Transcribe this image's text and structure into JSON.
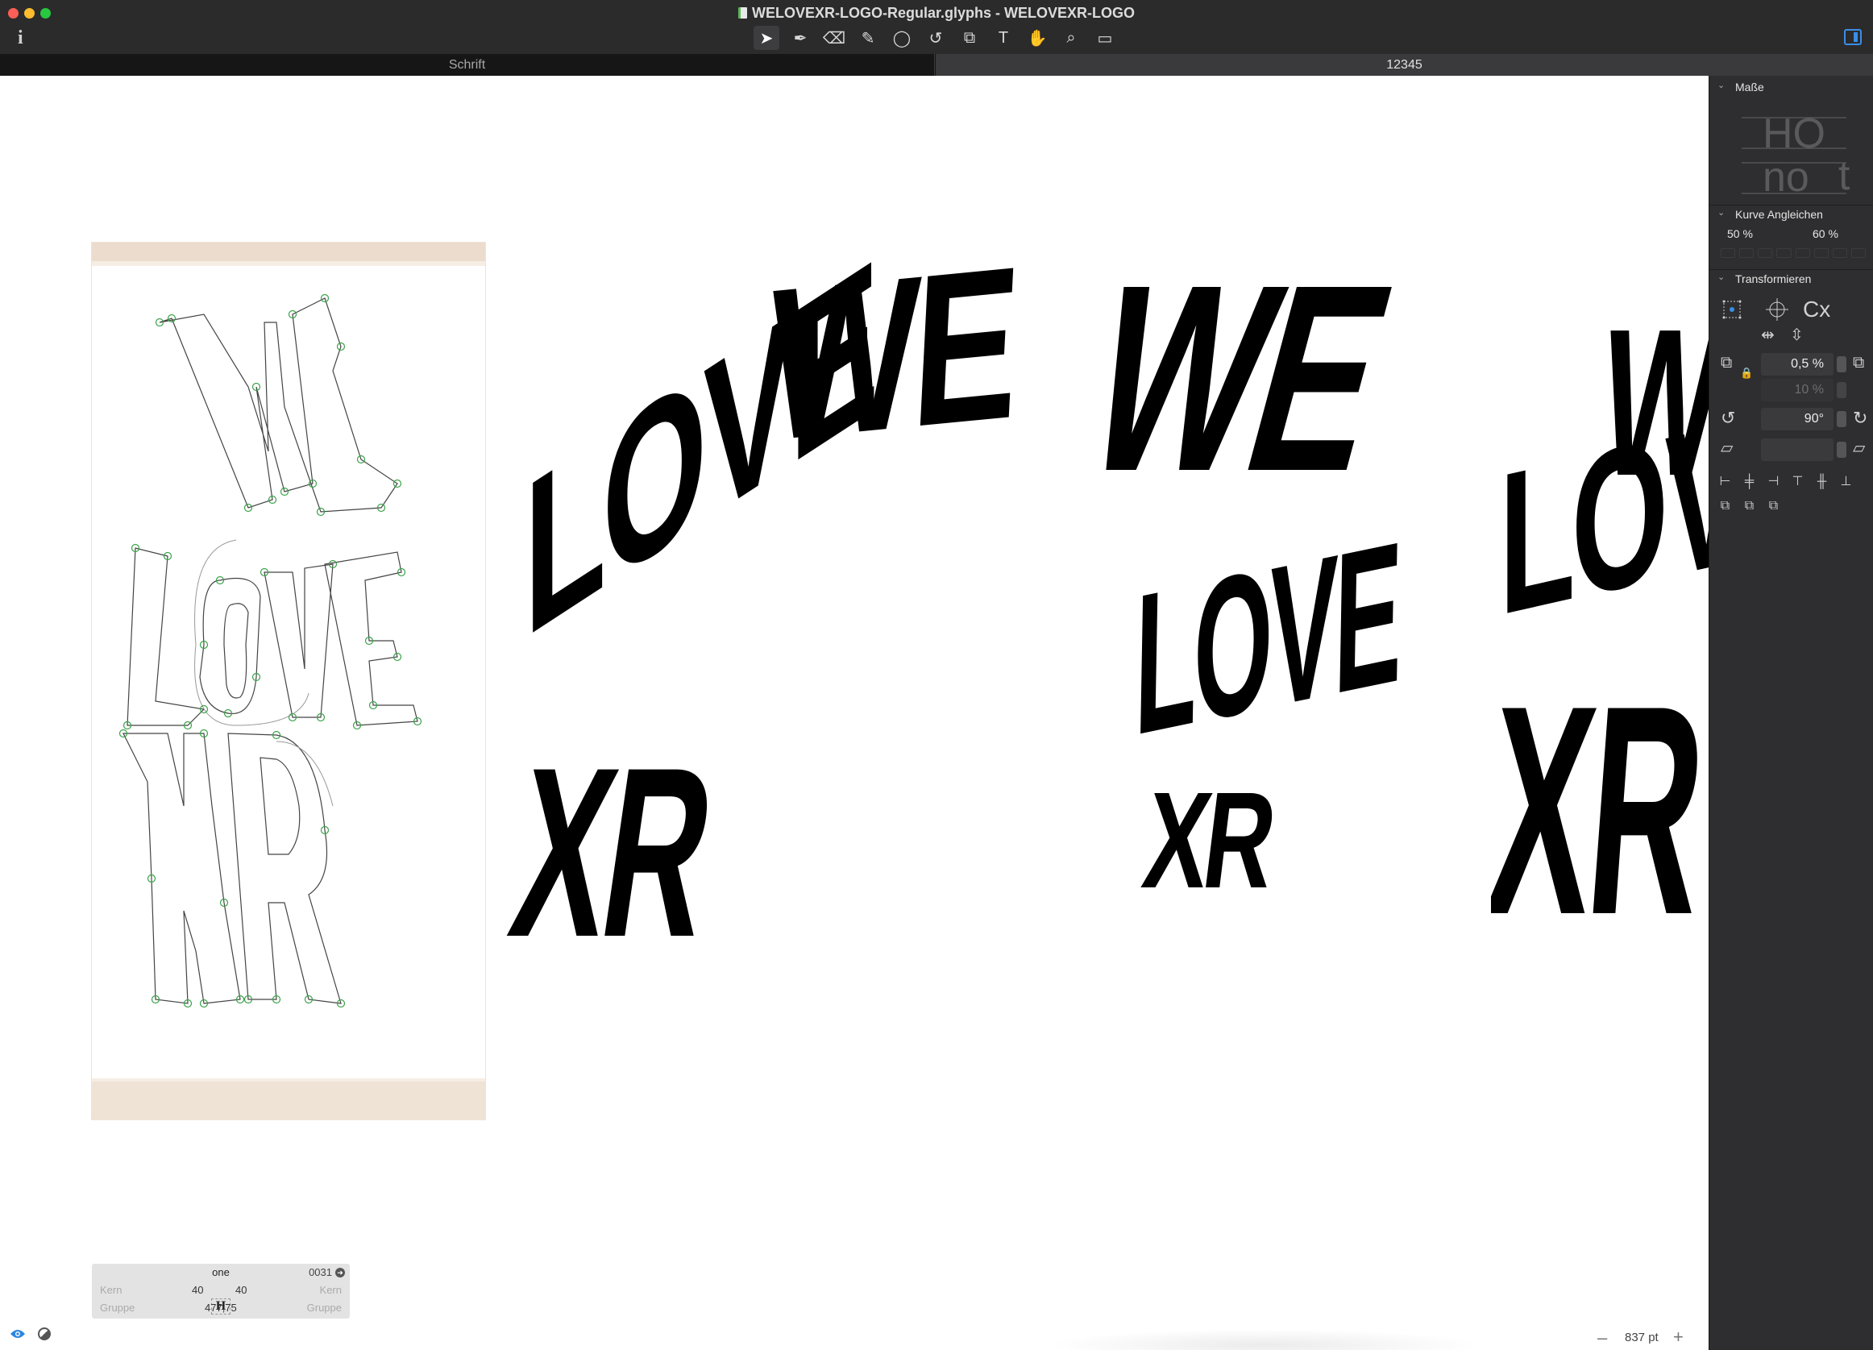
{
  "window": {
    "title": "WELOVEXR-LOGO-Regular.glyphs - WELOVEXR-LOGO",
    "info_label": "i",
    "traffic_colors": [
      "#ff5f57",
      "#febc2e",
      "#28c840"
    ]
  },
  "toolbar": {
    "tools": [
      {
        "name": "select-tool-icon",
        "glyph": "➤",
        "active": true
      },
      {
        "name": "pen-tool-icon",
        "glyph": "✒"
      },
      {
        "name": "eraser-tool-icon",
        "glyph": "⌫"
      },
      {
        "name": "pencil-tool-icon",
        "glyph": "✎"
      },
      {
        "name": "shape-tool-icon",
        "glyph": "◯"
      },
      {
        "name": "rotate-tool-icon",
        "glyph": "↺"
      },
      {
        "name": "scale-tool-icon",
        "glyph": "⧉"
      },
      {
        "name": "text-tool-icon",
        "glyph": "T"
      },
      {
        "name": "hand-tool-icon",
        "glyph": "✋"
      },
      {
        "name": "zoom-tool-icon",
        "glyph": "⌕"
      },
      {
        "name": "measure-tool-icon",
        "glyph": "▭"
      }
    ]
  },
  "tabs": [
    {
      "label": "Schrift"
    },
    {
      "label": "12345",
      "active": true
    }
  ],
  "canvas": {
    "logo_words": [
      "WE",
      "LOVE",
      "XR"
    ],
    "glyph_info": {
      "name": "one",
      "code": "0031",
      "kern_label": "Kern",
      "group_label": "Gruppe",
      "lsb": "40",
      "rsb": "40",
      "width": "477,75"
    },
    "zoom": "837 pt",
    "zoom_out": "–",
    "zoom_in": "+"
  },
  "panel": {
    "metrics": {
      "title": "Maße",
      "preview_upper": "HO",
      "preview_lower": "no",
      "preview_t": "t"
    },
    "curve": {
      "title": "Kurve Angleichen",
      "value_1": "50 %",
      "value_2": "60 %"
    },
    "transform": {
      "title": "Transformieren",
      "scale_x": "0,5 %",
      "scale_y": "10 %",
      "rotate": "90°",
      "slant": "",
      "origin_label": "Cx"
    }
  }
}
